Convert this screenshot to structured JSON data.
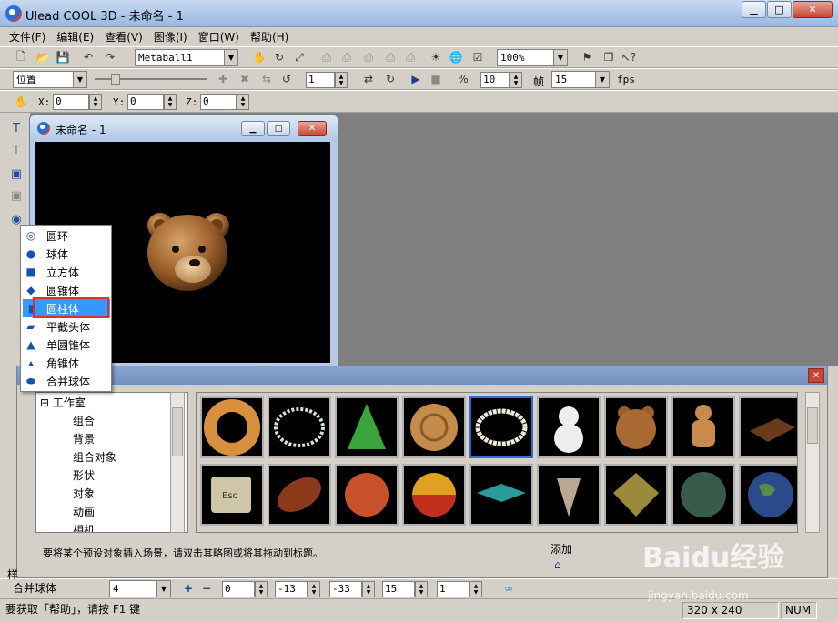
{
  "window": {
    "title": "Ulead COOL 3D - 未命名 - 1"
  },
  "menu": [
    "文件(F)",
    "编辑(E)",
    "查看(V)",
    "图像(I)",
    "窗口(W)",
    "帮助(H)"
  ],
  "toolbar1": {
    "object_combo": "Metaball1",
    "zoom_combo": "100%"
  },
  "toolbar2": {
    "mode_combo": "位置",
    "frame_value": "1",
    "fps_rate": "10",
    "frame_label": "帧",
    "frame_count": "15",
    "fps_label": "fps"
  },
  "toolbar3": {
    "x_label": "X:",
    "x_value": "0",
    "y_label": "Y:",
    "y_value": "0",
    "z_label": "Z:",
    "z_value": "0"
  },
  "child_window": {
    "title": "未命名 - 1"
  },
  "popup_menu": {
    "items": [
      "圆环",
      "球体",
      "立方体",
      "圆锥体",
      "圆柱体",
      "平截头体",
      "单圆锥体",
      "角锥体",
      "合并球体"
    ],
    "selected": "圆柱体"
  },
  "library": {
    "tree": {
      "root": "工作室",
      "children": [
        "组合",
        "背景",
        "组合对象",
        "形状",
        "对象",
        "动画",
        "相机"
      ]
    },
    "hint": "要将某个预设对象插入场景，请双击其略图或将其拖动到标题。",
    "add_label": "添加",
    "thumbnails_row1": [
      "donut",
      "bead-ring",
      "cone-tree",
      "spiral-disc",
      "pearl-necklace",
      "snowman",
      "bear-head",
      "gingerbread-man",
      "chocolate-bar"
    ],
    "thumbnails_row2": [
      "esc-key",
      "football",
      "basketball",
      "ball",
      "spinning-top",
      "shell-cone",
      "gem-diamond",
      "landscape-sphere",
      "earth-globe"
    ]
  },
  "attrbar": {
    "side_label": "样",
    "object_name": "合并球体",
    "combo_value": "4",
    "v1": "0",
    "v2": "-13",
    "v3": "-33",
    "v4": "15",
    "v5": "1"
  },
  "statusbar": {
    "help_text": "要获取「帮助」，请按 F1 键",
    "size": "320 x 240",
    "num": "NUM"
  },
  "watermark": {
    "text": "Baidu经验",
    "url": "jingyan.baidu.com"
  }
}
